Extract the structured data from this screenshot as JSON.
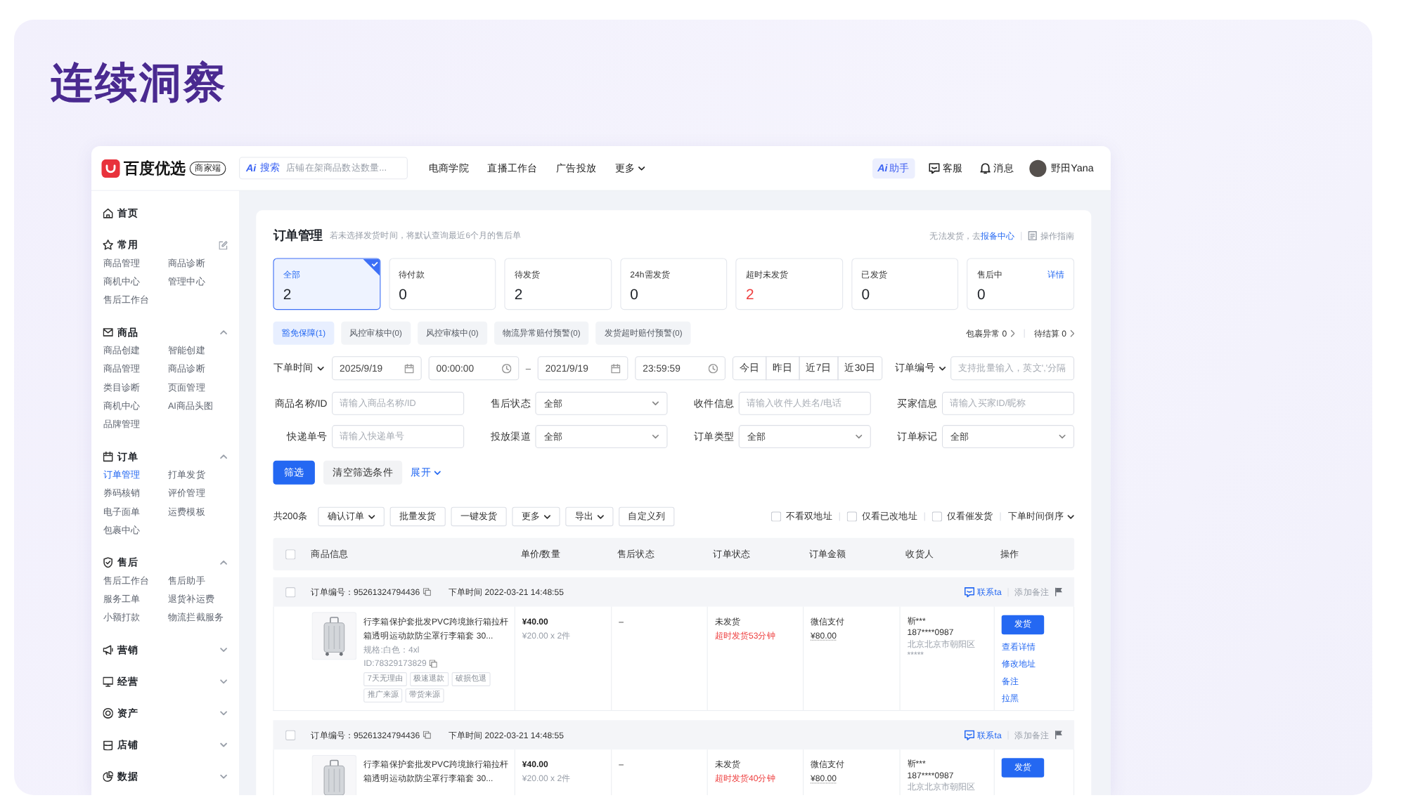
{
  "page_title": "连续洞察",
  "topbar": {
    "brand": "百度优选",
    "brand_badge": "商家端",
    "search": {
      "ai_mark": "Ai",
      "label": "搜索",
      "placeholder": "店铺在架商品数达数量..."
    },
    "nav": [
      {
        "label": "电商学院",
        "dropdown": false
      },
      {
        "label": "直播工作台",
        "dropdown": false
      },
      {
        "label": "广告投放",
        "dropdown": false
      },
      {
        "label": "更多",
        "dropdown": true
      }
    ],
    "assistant": {
      "ai_mark": "Ai",
      "label": "助手"
    },
    "service": "客服",
    "messages": "消息",
    "user": "野田Yana"
  },
  "sidebar": [
    {
      "kind": "link",
      "label": "首页"
    },
    {
      "kind": "editable",
      "label": "常用",
      "items": [
        {
          "label": "商品管理",
          "selected": false
        },
        {
          "label": "商品诊断",
          "selected": false
        },
        {
          "label": "商机中心",
          "selected": false
        },
        {
          "label": "管理中心",
          "selected": false
        },
        {
          "label": "售后工作台",
          "selected": false
        }
      ]
    },
    {
      "kind": "group",
      "label": "商品",
      "expanded": true,
      "items": [
        {
          "label": "商品创建",
          "selected": false
        },
        {
          "label": "智能创建",
          "selected": false
        },
        {
          "label": "商品管理",
          "selected": false
        },
        {
          "label": "商品诊断",
          "selected": false
        },
        {
          "label": "类目诊断",
          "selected": false
        },
        {
          "label": "页面管理",
          "selected": false
        },
        {
          "label": "商机中心",
          "selected": false
        },
        {
          "label": "AI商品头图",
          "selected": false
        },
        {
          "label": "品牌管理",
          "selected": false
        }
      ]
    },
    {
      "kind": "group",
      "label": "订单",
      "expanded": true,
      "items": [
        {
          "label": "订单管理",
          "selected": true
        },
        {
          "label": "打单发货",
          "selected": false
        },
        {
          "label": "券码核销",
          "selected": false
        },
        {
          "label": "评价管理",
          "selected": false
        },
        {
          "label": "电子面单",
          "selected": false
        },
        {
          "label": "运费模板",
          "selected": false
        },
        {
          "label": "包裹中心",
          "selected": false
        }
      ]
    },
    {
      "kind": "group",
      "label": "售后",
      "expanded": true,
      "items": [
        {
          "label": "售后工作台",
          "selected": false
        },
        {
          "label": "售后助手",
          "selected": false
        },
        {
          "label": "服务工单",
          "selected": false
        },
        {
          "label": "退货补运费",
          "selected": false
        },
        {
          "label": "小额打款",
          "selected": false
        },
        {
          "label": "物流拦截服务",
          "selected": false
        }
      ]
    },
    {
      "kind": "group",
      "label": "营销",
      "expanded": false
    },
    {
      "kind": "group",
      "label": "经营",
      "expanded": false
    },
    {
      "kind": "group",
      "label": "资产",
      "expanded": false
    },
    {
      "kind": "group",
      "label": "店铺",
      "expanded": false
    },
    {
      "kind": "group",
      "label": "数据",
      "expanded": false
    }
  ],
  "main": {
    "title": "订单管理",
    "subtitle": "若未选择发货时间，将默认查询最近6个月的售后单",
    "notice": "无法发货，去",
    "notice_link": "报备中心",
    "guide": "操作指南",
    "stats": [
      {
        "label": "全部",
        "value": "2",
        "selected": true,
        "alert": false
      },
      {
        "label": "待付款",
        "value": "0",
        "selected": false,
        "alert": false
      },
      {
        "label": "待发货",
        "value": "2",
        "selected": false,
        "alert": false
      },
      {
        "label": "24h需发货",
        "value": "0",
        "selected": false,
        "alert": false
      },
      {
        "label": "超时未发货",
        "value": "2",
        "selected": false,
        "alert": true
      },
      {
        "label": "已发货",
        "value": "0",
        "selected": false,
        "alert": false
      },
      {
        "label": "售后中",
        "value": "0",
        "selected": false,
        "alert": false,
        "link": "详情"
      }
    ],
    "chips": [
      {
        "label": "豁免保障(1)",
        "selected": true
      },
      {
        "label": "风控审核中(0)",
        "selected": false
      },
      {
        "label": "风控审核中(0)",
        "selected": false
      },
      {
        "label": "物流异常赔付预警(0)",
        "selected": false
      },
      {
        "label": "发货超时赔付预警(0)",
        "selected": false
      }
    ],
    "chip_links": [
      "包裹异常 0",
      "待结算 0"
    ],
    "filters": {
      "date_range": {
        "label": "下单时间",
        "start_date": "2025/9/19",
        "start_time": "00:00:00",
        "separator": "–",
        "end_date": "2021/9/19",
        "end_time": "23:59:59"
      },
      "quick_ranges": [
        {
          "label": "今日",
          "selected": false
        },
        {
          "label": "昨日",
          "selected": false
        },
        {
          "label": "近7日",
          "selected": false
        },
        {
          "label": "近30日",
          "selected": false
        }
      ],
      "order_no": {
        "label": "订单编号",
        "placeholder": "支持批量输入，英文','分隔"
      },
      "fields": [
        {
          "kind": "input",
          "label": "商品名称/ID",
          "placeholder": "请输入商品名称/ID"
        },
        {
          "kind": "select",
          "label": "售后状态",
          "value": "全部"
        },
        {
          "kind": "input",
          "label": "收件信息",
          "placeholder": "请输入收件人姓名/电话"
        },
        {
          "kind": "input",
          "label": "买家信息",
          "placeholder": "请输入买家ID/昵称"
        },
        {
          "kind": "input",
          "label": "快递单号",
          "placeholder": "请输入快递单号"
        },
        {
          "kind": "select",
          "label": "投放渠道",
          "value": "全部"
        },
        {
          "kind": "select",
          "label": "订单类型",
          "value": "全部"
        },
        {
          "kind": "select",
          "label": "订单标记",
          "value": "全部"
        }
      ]
    },
    "actions": [
      {
        "kind": "primary",
        "label": "筛选"
      },
      {
        "kind": "secondary",
        "label": "清空筛选条件"
      },
      {
        "kind": "link",
        "label": "展开"
      }
    ],
    "toolbar": {
      "count": "共200条",
      "buttons": [
        {
          "label": "确认订单",
          "dropdown": true
        },
        {
          "label": "批量发货",
          "dropdown": false
        },
        {
          "label": "一键发货",
          "dropdown": false
        },
        {
          "label": "更多",
          "dropdown": true
        },
        {
          "label": "导出",
          "dropdown": true
        },
        {
          "label": "自定义列",
          "dropdown": false
        }
      ],
      "options": [
        {
          "label": "不看双地址",
          "checked": false
        },
        {
          "label": "仅看已改地址",
          "checked": false
        },
        {
          "label": "仅看催发货",
          "checked": false
        }
      ],
      "sort": "下单时间倒序"
    },
    "table": {
      "select_all": false,
      "columns": [
        "商品信息",
        "单价/数量",
        "售后状态",
        "订单状态",
        "订单金额",
        "收货人",
        "操作"
      ],
      "orders": [
        {
          "checked": false,
          "order_no": "订单编号：95261324794436",
          "time": "下单时间 2022-03-21 14:48:55",
          "contact": "联系ta",
          "note": "添加备注",
          "title": "行李箱保护套批发PVC跨境旅行箱拉杆箱透明运动款防尘罩行李箱套 30...",
          "spec": "规格:白色：4xl",
          "product_id": "ID:78329173829",
          "tags": [
            "7天无理由",
            "极速退款",
            "破损包退",
            "推广来源",
            "带货来源"
          ],
          "price": "¥40.00",
          "unit_qty": "¥20.00 x 2件",
          "after_sale": "–",
          "status": "未发货",
          "overdue": "超时发货53分钟",
          "payment": "微信支付",
          "amount": "¥80.00",
          "receiver_name": "靳***",
          "receiver_phone": "187****0987",
          "address_lines": [
            "北京北京市朝阳区",
            "*****"
          ],
          "primary_action": "发货",
          "links": [
            "查看详情",
            "修改地址",
            "备注",
            "拉黑"
          ]
        },
        {
          "checked": false,
          "order_no": "订单编号：95261324794436",
          "time": "下单时间 2022-03-21 14:48:55",
          "contact": "联系ta",
          "note": "添加备注",
          "title": "行李箱保护套批发PVC跨境旅行箱拉杆箱透明运动款防尘罩行李箱套 30...",
          "price": "¥40.00",
          "unit_qty": "¥20.00 x 2件",
          "after_sale": "–",
          "status": "未发货",
          "overdue": "超时发货40分钟",
          "payment": "微信支付",
          "amount": "¥80.00",
          "receiver_name": "靳***",
          "receiver_phone": "187****0987",
          "address_lines": [
            "北京北京市朝阳区"
          ],
          "primary_action": "发货"
        }
      ]
    }
  }
}
